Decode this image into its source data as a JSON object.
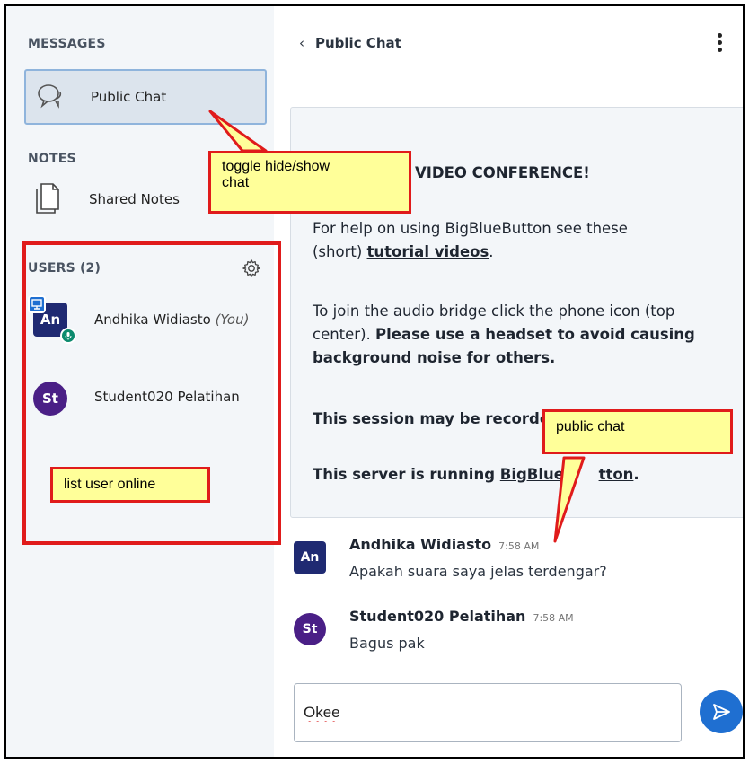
{
  "sidebar": {
    "messages_title": "MESSAGES",
    "public_chat_label": "Public Chat",
    "notes_title": "NOTES",
    "shared_notes_label": "Shared Notes",
    "users_title": "USERS (2)",
    "users": [
      {
        "initials": "An",
        "name": "Andhika Widiasto",
        "suffix": "(You)"
      },
      {
        "initials": "St",
        "name": "Student020 Pelatihan",
        "suffix": ""
      }
    ]
  },
  "chat": {
    "back_label": "Public Chat",
    "welcome": {
      "line1": "VIDEO CONFERENCE!",
      "line2_a": "For help on using BigBlueButton see these",
      "line2_b": "(short) ",
      "line2_link": "tutorial videos",
      "line2_end": ".",
      "line3_a": "To join the audio bridge click the phone icon (top",
      "line3_b": "center). ",
      "line3_bold1": "Please use a headset to avoid causing",
      "line3_bold2": "background noise for others.",
      "line4": "This session may be recorde",
      "line5_a": "This server is running ",
      "line5_link": "BigBlueB",
      "line5_link2": "tton",
      "line5_end": "."
    },
    "messages": [
      {
        "initials": "An",
        "name": "Andhika Widiasto",
        "time": "7:58 AM",
        "text": "Apakah suara saya jelas terdengar?"
      },
      {
        "initials": "St",
        "name": "Student020 Pelatihan",
        "time": "7:58 AM",
        "text": "Bagus pak"
      }
    ],
    "input_value": "Okee"
  },
  "annotations": {
    "toggle": "toggle hide/show\nchat",
    "toggle_l1": "toggle hide/show",
    "toggle_l2": "chat",
    "public_chat": "public chat",
    "list_user": "list user online"
  },
  "colors": {
    "accent": "#1f6fd1",
    "annotation_border": "#e01b1b",
    "annotation_fill": "#ffff99",
    "avatar_navy": "#1f2a72",
    "avatar_purple": "#4a1f86",
    "mic_green": "#0c8a6e"
  }
}
